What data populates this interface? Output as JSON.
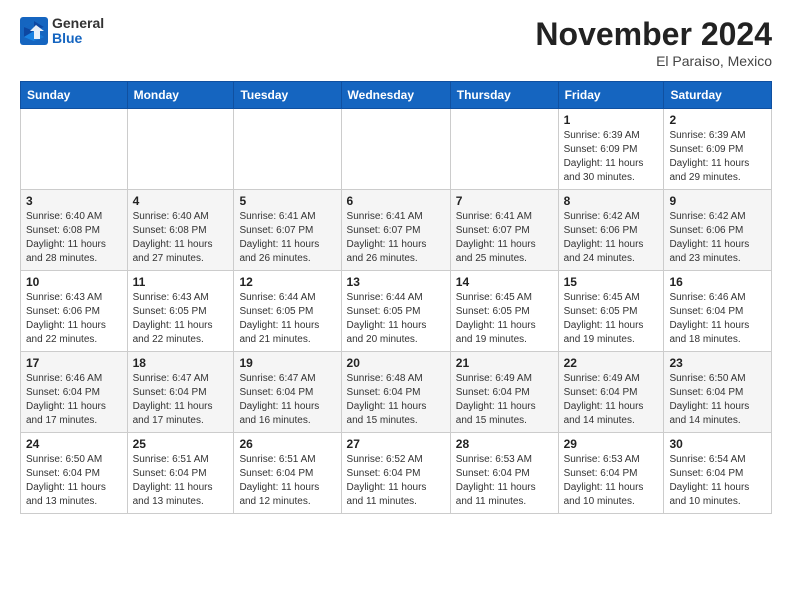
{
  "header": {
    "logo_general": "General",
    "logo_blue": "Blue",
    "month_title": "November 2024",
    "location": "El Paraiso, Mexico"
  },
  "days_of_week": [
    "Sunday",
    "Monday",
    "Tuesday",
    "Wednesday",
    "Thursday",
    "Friday",
    "Saturday"
  ],
  "weeks": [
    {
      "days": [
        {
          "number": "",
          "info": ""
        },
        {
          "number": "",
          "info": ""
        },
        {
          "number": "",
          "info": ""
        },
        {
          "number": "",
          "info": ""
        },
        {
          "number": "",
          "info": ""
        },
        {
          "number": "1",
          "info": "Sunrise: 6:39 AM\nSunset: 6:09 PM\nDaylight: 11 hours and 30 minutes."
        },
        {
          "number": "2",
          "info": "Sunrise: 6:39 AM\nSunset: 6:09 PM\nDaylight: 11 hours and 29 minutes."
        }
      ]
    },
    {
      "days": [
        {
          "number": "3",
          "info": "Sunrise: 6:40 AM\nSunset: 6:08 PM\nDaylight: 11 hours and 28 minutes."
        },
        {
          "number": "4",
          "info": "Sunrise: 6:40 AM\nSunset: 6:08 PM\nDaylight: 11 hours and 27 minutes."
        },
        {
          "number": "5",
          "info": "Sunrise: 6:41 AM\nSunset: 6:07 PM\nDaylight: 11 hours and 26 minutes."
        },
        {
          "number": "6",
          "info": "Sunrise: 6:41 AM\nSunset: 6:07 PM\nDaylight: 11 hours and 26 minutes."
        },
        {
          "number": "7",
          "info": "Sunrise: 6:41 AM\nSunset: 6:07 PM\nDaylight: 11 hours and 25 minutes."
        },
        {
          "number": "8",
          "info": "Sunrise: 6:42 AM\nSunset: 6:06 PM\nDaylight: 11 hours and 24 minutes."
        },
        {
          "number": "9",
          "info": "Sunrise: 6:42 AM\nSunset: 6:06 PM\nDaylight: 11 hours and 23 minutes."
        }
      ]
    },
    {
      "days": [
        {
          "number": "10",
          "info": "Sunrise: 6:43 AM\nSunset: 6:06 PM\nDaylight: 11 hours and 22 minutes."
        },
        {
          "number": "11",
          "info": "Sunrise: 6:43 AM\nSunset: 6:05 PM\nDaylight: 11 hours and 22 minutes."
        },
        {
          "number": "12",
          "info": "Sunrise: 6:44 AM\nSunset: 6:05 PM\nDaylight: 11 hours and 21 minutes."
        },
        {
          "number": "13",
          "info": "Sunrise: 6:44 AM\nSunset: 6:05 PM\nDaylight: 11 hours and 20 minutes."
        },
        {
          "number": "14",
          "info": "Sunrise: 6:45 AM\nSunset: 6:05 PM\nDaylight: 11 hours and 19 minutes."
        },
        {
          "number": "15",
          "info": "Sunrise: 6:45 AM\nSunset: 6:05 PM\nDaylight: 11 hours and 19 minutes."
        },
        {
          "number": "16",
          "info": "Sunrise: 6:46 AM\nSunset: 6:04 PM\nDaylight: 11 hours and 18 minutes."
        }
      ]
    },
    {
      "days": [
        {
          "number": "17",
          "info": "Sunrise: 6:46 AM\nSunset: 6:04 PM\nDaylight: 11 hours and 17 minutes."
        },
        {
          "number": "18",
          "info": "Sunrise: 6:47 AM\nSunset: 6:04 PM\nDaylight: 11 hours and 17 minutes."
        },
        {
          "number": "19",
          "info": "Sunrise: 6:47 AM\nSunset: 6:04 PM\nDaylight: 11 hours and 16 minutes."
        },
        {
          "number": "20",
          "info": "Sunrise: 6:48 AM\nSunset: 6:04 PM\nDaylight: 11 hours and 15 minutes."
        },
        {
          "number": "21",
          "info": "Sunrise: 6:49 AM\nSunset: 6:04 PM\nDaylight: 11 hours and 15 minutes."
        },
        {
          "number": "22",
          "info": "Sunrise: 6:49 AM\nSunset: 6:04 PM\nDaylight: 11 hours and 14 minutes."
        },
        {
          "number": "23",
          "info": "Sunrise: 6:50 AM\nSunset: 6:04 PM\nDaylight: 11 hours and 14 minutes."
        }
      ]
    },
    {
      "days": [
        {
          "number": "24",
          "info": "Sunrise: 6:50 AM\nSunset: 6:04 PM\nDaylight: 11 hours and 13 minutes."
        },
        {
          "number": "25",
          "info": "Sunrise: 6:51 AM\nSunset: 6:04 PM\nDaylight: 11 hours and 13 minutes."
        },
        {
          "number": "26",
          "info": "Sunrise: 6:51 AM\nSunset: 6:04 PM\nDaylight: 11 hours and 12 minutes."
        },
        {
          "number": "27",
          "info": "Sunrise: 6:52 AM\nSunset: 6:04 PM\nDaylight: 11 hours and 11 minutes."
        },
        {
          "number": "28",
          "info": "Sunrise: 6:53 AM\nSunset: 6:04 PM\nDaylight: 11 hours and 11 minutes."
        },
        {
          "number": "29",
          "info": "Sunrise: 6:53 AM\nSunset: 6:04 PM\nDaylight: 11 hours and 10 minutes."
        },
        {
          "number": "30",
          "info": "Sunrise: 6:54 AM\nSunset: 6:04 PM\nDaylight: 11 hours and 10 minutes."
        }
      ]
    }
  ]
}
